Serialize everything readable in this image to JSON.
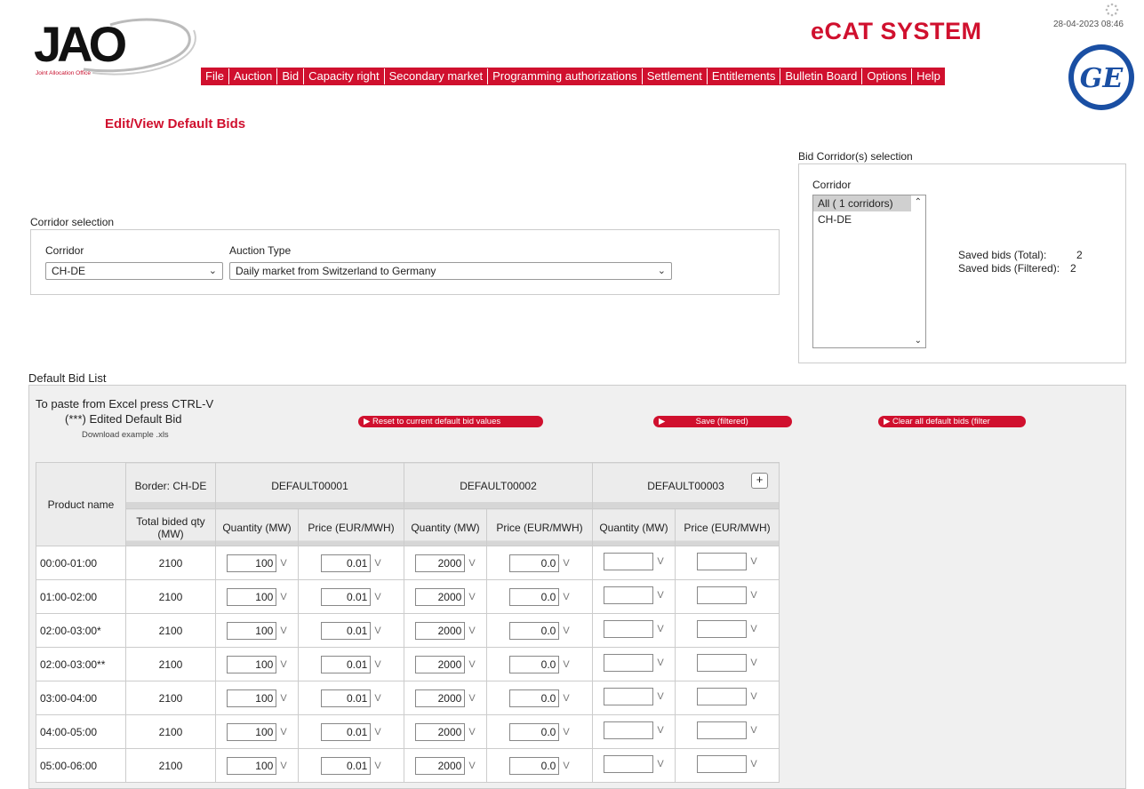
{
  "header": {
    "logo_text": "JAO",
    "logo_subtitle": "Joint Allocation Office",
    "system_title": "eCAT SYSTEM",
    "datetime": "28-04-2023 08:46",
    "menu": [
      "File",
      "Auction",
      "Bid",
      "Capacity right",
      "Secondary market",
      "Programming authorizations",
      "Settlement",
      "Entitlements",
      "Bulletin Board",
      "Options",
      "Help"
    ]
  },
  "page_title": "Edit/View Default Bids",
  "corridor_selection": {
    "group_label": "Corridor selection",
    "corridor_label": "Corridor",
    "corridor_value": "CH-DE",
    "auction_type_label": "Auction Type",
    "auction_type_value": "Daily market from Switzerland to Germany"
  },
  "bid_corridor_selection": {
    "group_label": "Bid Corridor(s) selection",
    "corridor_label": "Corridor",
    "options": [
      "All ( 1 corridors)",
      "CH-DE"
    ],
    "saved_total_label": "Saved bids (Total):",
    "saved_total_value": "2",
    "saved_filtered_label": "Saved bids (Filtered):",
    "saved_filtered_value": "2"
  },
  "default_bid_list": {
    "group_label": "Default Bid List",
    "paste_hint": "To paste from Excel press CTRL-V",
    "edited_hint": "(***) Edited Default Bid",
    "download_link": "Download example .xls",
    "reset_button": "Reset to current default bid values",
    "save_button": "Save (filtered)",
    "clear_button": "Clear all default bids (filter",
    "table": {
      "product_header": "Product name",
      "border_header": "Border: CH-DE",
      "total_header": "Total bided qty (MW)",
      "bid_columns": [
        "DEFAULT00001",
        "DEFAULT00002",
        "DEFAULT00003"
      ],
      "quantity_header": "Quantity (MW)",
      "price_header": "Price (EUR/MWH)",
      "v_marker": "V",
      "plus": "+",
      "rows": [
        {
          "product": "00:00-01:00",
          "total": "2100",
          "q1": "100",
          "p1": "0.01",
          "q2": "2000",
          "p2": "0.0",
          "q3": "",
          "p3": ""
        },
        {
          "product": "01:00-02:00",
          "total": "2100",
          "q1": "100",
          "p1": "0.01",
          "q2": "2000",
          "p2": "0.0",
          "q3": "",
          "p3": ""
        },
        {
          "product": "02:00-03:00*",
          "total": "2100",
          "q1": "100",
          "p1": "0.01",
          "q2": "2000",
          "p2": "0.0",
          "q3": "",
          "p3": ""
        },
        {
          "product": "02:00-03:00**",
          "total": "2100",
          "q1": "100",
          "p1": "0.01",
          "q2": "2000",
          "p2": "0.0",
          "q3": "",
          "p3": ""
        },
        {
          "product": "03:00-04:00",
          "total": "2100",
          "q1": "100",
          "p1": "0.01",
          "q2": "2000",
          "p2": "0.0",
          "q3": "",
          "p3": ""
        },
        {
          "product": "04:00-05:00",
          "total": "2100",
          "q1": "100",
          "p1": "0.01",
          "q2": "2000",
          "p2": "0.0",
          "q3": "",
          "p3": ""
        },
        {
          "product": "05:00-06:00",
          "total": "2100",
          "q1": "100",
          "p1": "0.01",
          "q2": "2000",
          "p2": "0.0",
          "q3": "",
          "p3": ""
        }
      ]
    }
  }
}
